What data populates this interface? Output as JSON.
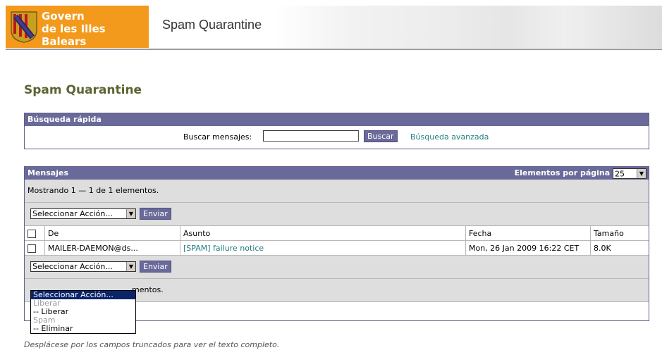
{
  "header": {
    "logo_line1": "Govern",
    "logo_line2": "de les Illes Balears",
    "app_title": "Spam Quarantine"
  },
  "page_title": "Spam Quarantine",
  "quick_search": {
    "title": "Búsqueda rápida",
    "label": "Buscar mensajes:",
    "input_value": "",
    "button": "Buscar",
    "advanced_link": "Búsqueda avanzada"
  },
  "messages": {
    "title": "Mensajes",
    "per_page_label": "Elementos por página",
    "per_page_value": "25",
    "showing": "Mostrando 1 — 1 de 1 elementos.",
    "showing_partial": "mentos.",
    "action_select": "Seleccionar Acción...",
    "send_button": "Enviar",
    "columns": [
      "De",
      "Asunto",
      "Fecha",
      "Tamaño"
    ],
    "rows": [
      {
        "from": "MAILER-DAEMON@ds...",
        "subject": "[SPAM] failure notice",
        "date": "Mon, 26 Jan 2009 16:22 CET",
        "size": "8.0K"
      }
    ]
  },
  "dropdown_options": [
    {
      "label": "Seleccionar Acción...",
      "kind": "selected"
    },
    {
      "label": "Liberar",
      "kind": "group"
    },
    {
      "label": "-- Liberar",
      "kind": "option"
    },
    {
      "label": "Spam",
      "kind": "group"
    },
    {
      "label": "-- Eliminar",
      "kind": "option"
    }
  ],
  "footer_note": "Desplácese por los campos truncados para ver el texto completo.",
  "colors": {
    "brand_orange": "#f39a1c",
    "panel_header": "#6a6a9a",
    "title_green": "#5a6532",
    "link_teal": "#227c7c"
  }
}
